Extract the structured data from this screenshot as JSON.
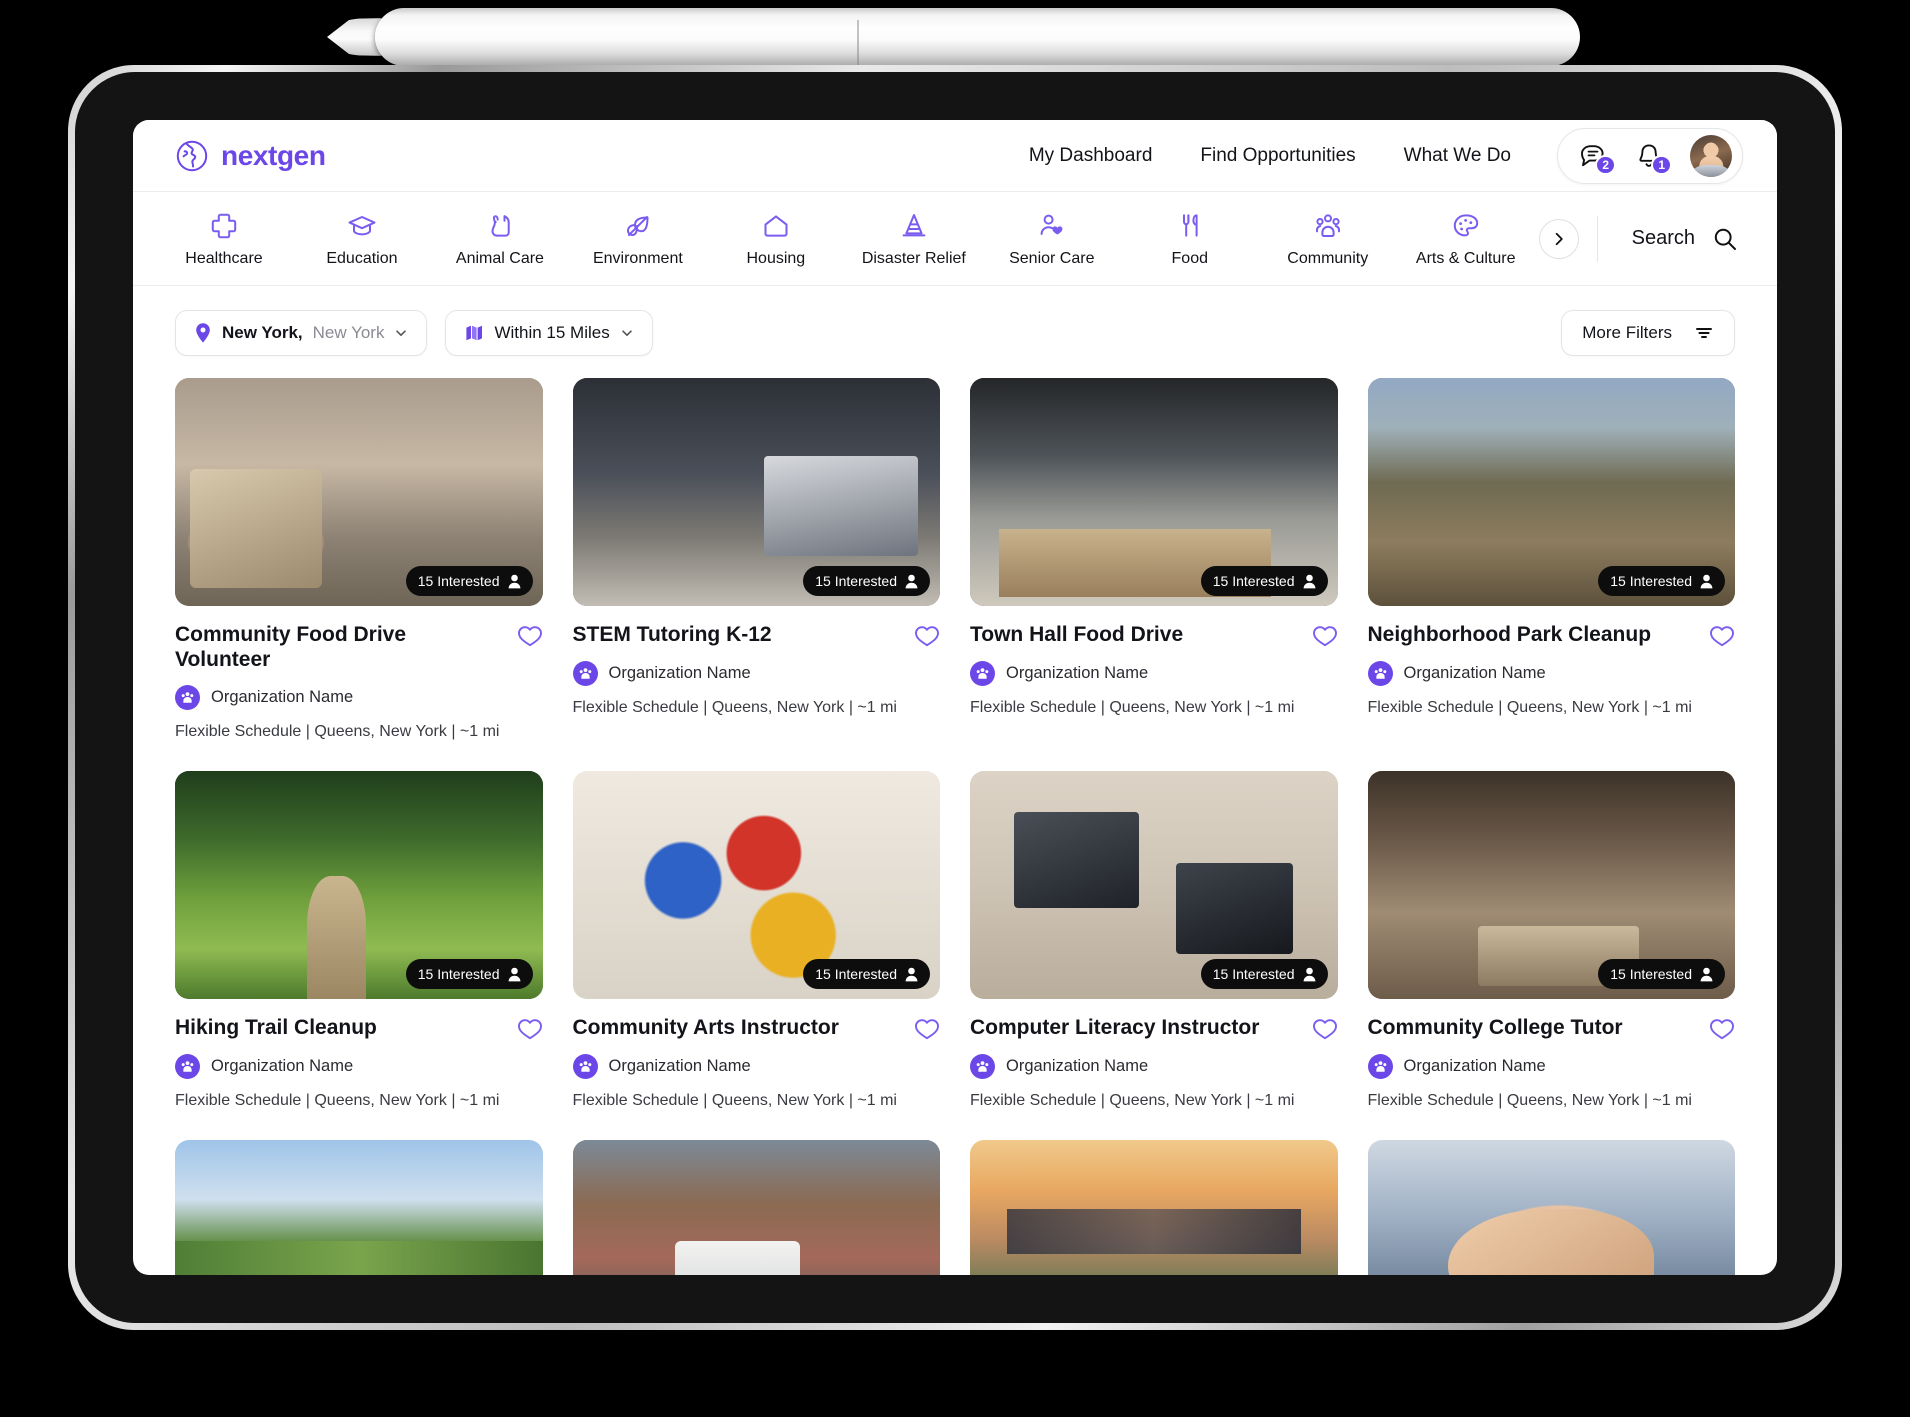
{
  "brand": {
    "name": "nextgen",
    "color": "#6c47e8",
    "logo_icon": "globe-icon"
  },
  "header": {
    "nav": [
      {
        "label": "My Dashboard"
      },
      {
        "label": "Find Opportunities"
      },
      {
        "label": "What We Do"
      }
    ],
    "actions": {
      "messages_icon": "chat-bubble-icon",
      "messages_count": "2",
      "notifications_icon": "bell-icon",
      "notifications_count": "1",
      "avatar": "user-avatar"
    }
  },
  "categories": [
    {
      "label": "Healthcare",
      "icon": "medical-cross-icon"
    },
    {
      "label": "Education",
      "icon": "graduation-cap-icon"
    },
    {
      "label": "Animal Care",
      "icon": "cat-icon"
    },
    {
      "label": "Environment",
      "icon": "leaf-icon"
    },
    {
      "label": "Housing",
      "icon": "house-icon"
    },
    {
      "label": "Disaster Relief",
      "icon": "traffic-cone-icon"
    },
    {
      "label": "Senior Care",
      "icon": "person-heart-icon"
    },
    {
      "label": "Food",
      "icon": "fork-knife-icon"
    },
    {
      "label": "Community",
      "icon": "people-group-icon"
    },
    {
      "label": "Arts & Culture",
      "icon": "paint-palette-icon"
    }
  ],
  "category_next_icon": "chevron-right-icon",
  "search": {
    "label": "Search",
    "icon": "magnifier-icon"
  },
  "filters": {
    "location": {
      "city": "New York,",
      "state": "New York",
      "icon": "map-pin-icon",
      "chevron": "chevron-down-icon"
    },
    "distance": {
      "label": "Within 15 Miles",
      "icon": "map-icon",
      "chevron": "chevron-down-icon"
    },
    "more_filters": {
      "label": "More Filters",
      "icon": "filter-lines-icon"
    }
  },
  "card_defaults": {
    "interested_label": "15 Interested",
    "interested_icon": "person-icon",
    "organization": "Organization Name",
    "organization_icon": "people-group-icon",
    "meta": "Flexible Schedule | Queens, New York | ~1 mi",
    "favorite_icon": "heart-outline-icon"
  },
  "cards": [
    {
      "title": "Community Food Drive Volunteer",
      "art": "a1"
    },
    {
      "title": "STEM Tutoring K-12",
      "art": "a2"
    },
    {
      "title": "Town Hall Food Drive",
      "art": "a3"
    },
    {
      "title": "Neighborhood Park Cleanup",
      "art": "a4"
    },
    {
      "title": "Hiking Trail Cleanup",
      "art": "a5"
    },
    {
      "title": "Community Arts Instructor",
      "art": "a6"
    },
    {
      "title": "Computer Literacy Instructor",
      "art": "a7"
    },
    {
      "title": "Community College Tutor",
      "art": "a8"
    },
    {
      "title": "",
      "art": "a9"
    },
    {
      "title": "",
      "art": "a10"
    },
    {
      "title": "",
      "art": "a11"
    },
    {
      "title": "",
      "art": "a12"
    }
  ]
}
